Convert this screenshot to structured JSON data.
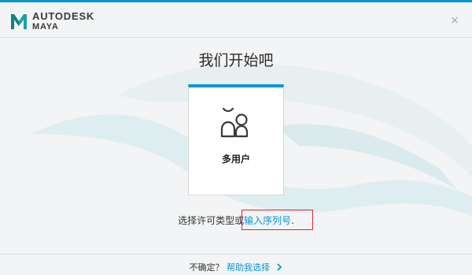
{
  "header": {
    "brand_line1": "AUTODESK",
    "brand_line2": "MAYA",
    "close_glyph": "×",
    "logo_icon": "maya-m-logo-icon",
    "close_icon": "close-icon"
  },
  "main": {
    "title": "我们开始吧",
    "card": {
      "label": "多用户",
      "icon": "users-icon"
    },
    "license_prompt": "选择许可类型或",
    "serial_link": "输入序列号",
    "license_suffix": "."
  },
  "footer": {
    "unsure": "不确定？",
    "help_link": "帮助我选择",
    "chevron_icon": "chevron-right-icon"
  },
  "colors": {
    "accent": "#0696d7",
    "highlight": "#e8232a",
    "logo_teal": "#1aa0a8"
  }
}
